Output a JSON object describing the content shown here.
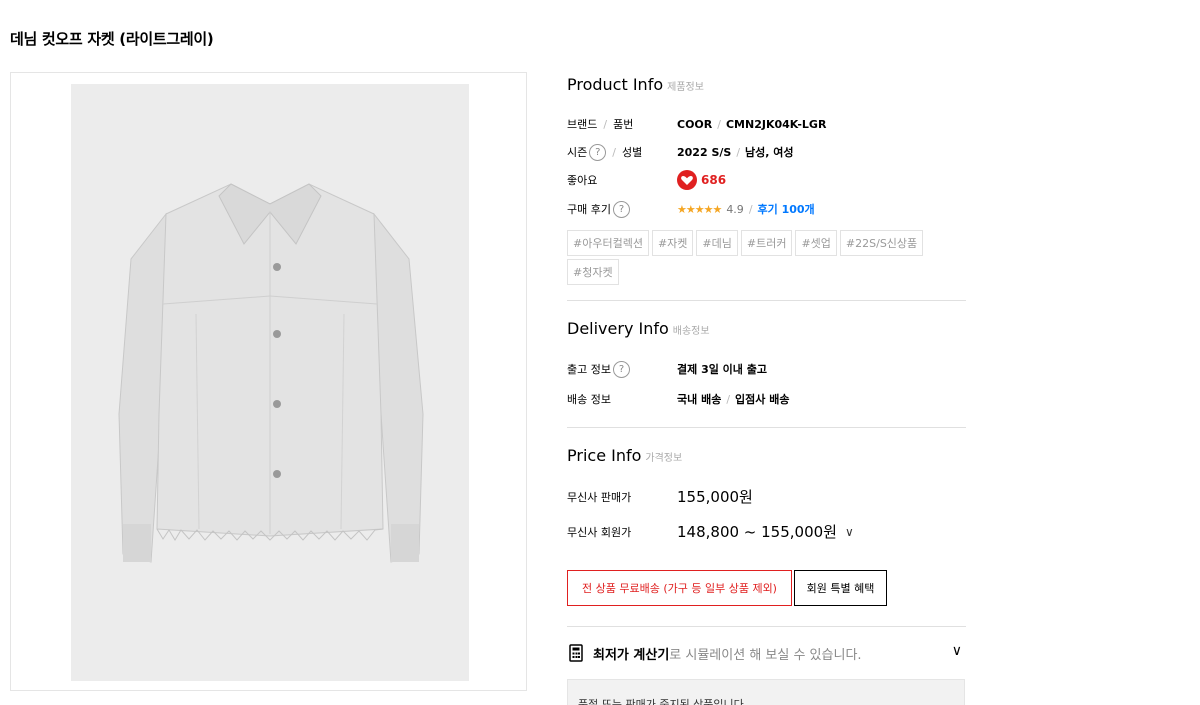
{
  "page_title": "데님 컷오프 자켓 (라이트그레이)",
  "product_info": {
    "title": "Product Info",
    "subtitle": "제품정보",
    "brand_label": "브랜드",
    "part_label": "품번",
    "brand": "COOR",
    "part_no": "CMN2JK04K-LGR",
    "season_label": "시즌",
    "gender_label": "성별",
    "season": "2022 S/S",
    "gender": "남성, 여성",
    "likes_label": "좋아요",
    "likes_count": "686",
    "review_label": "구매 후기",
    "stars": "★★★★★",
    "rating": "4.9",
    "review_link": "후기 100개",
    "help_glyph": "?",
    "separator": "/"
  },
  "tags": [
    "#아우터컬렉션",
    "#자켓",
    "#데님",
    "#트러커",
    "#셋업",
    "#22S/S신상품",
    "#청자켓"
  ],
  "delivery_info": {
    "title": "Delivery Info",
    "subtitle": "배송정보",
    "ship_label": "출고 정보",
    "ship_value": "결제 3일 이내 출고",
    "method_label": "배송 정보",
    "method_domestic": "국내 배송",
    "method_partner": "입점사 배송"
  },
  "price_info": {
    "title": "Price Info",
    "subtitle": "가격정보",
    "sale_label": "무신사 판매가",
    "sale_price": "155,000원",
    "member_label": "무신사 회원가",
    "member_price": "148,800 ~ 155,000원",
    "chevron": "∨"
  },
  "buttons": {
    "free_shipping": "전 상품 무료배송 (가구 등 일부 상품 제외)",
    "member_benefit": "회원 특별 혜택"
  },
  "calculator": {
    "bold": "최저가 계산기",
    "rest": "로 시뮬레이션 해 보실 수 있습니다.",
    "toggle": "∨"
  },
  "notice": "품절 또는 판매가 중지된 상품입니다.",
  "colors": {
    "accent_red": "#e02020",
    "link_blue": "#0078ff",
    "star": "#f5a623"
  },
  "icons": {
    "heart": "heart-icon",
    "help": "help-icon",
    "calculator": "calculator-icon",
    "chevron": "chevron-down-icon"
  }
}
